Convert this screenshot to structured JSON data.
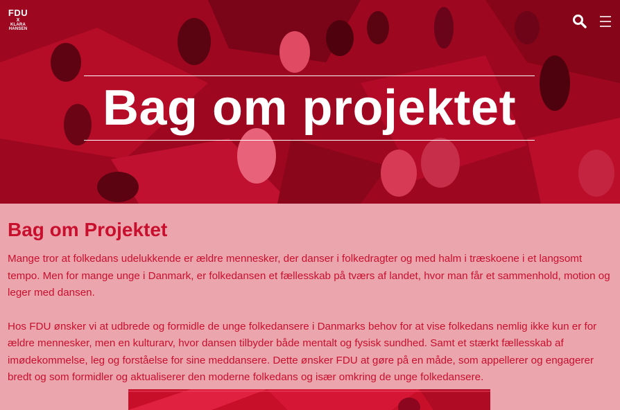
{
  "logo": {
    "line1": "FDU",
    "line2": "X",
    "line3": "KLARA",
    "line4": "HANSEN"
  },
  "header": {
    "search_icon": "search-icon",
    "menu_icon": "hamburger-menu-icon"
  },
  "hero": {
    "title": "Bag om projektet"
  },
  "main": {
    "heading": "Bag om Projektet",
    "paragraphs": [
      "Mange tror at folkedans udelukkende er ældre mennesker, der danser i folkedragter og med halm i træskoene i et langsomt tempo. Men for mange unge i Danmark, er folkedansen et fællesskab på tværs af landet, hvor man får et sammenhold, motion og leger med dansen.",
      "Hos FDU ønsker vi at udbrede og formidle de unge folkedansere i Danmarks behov for at vise folkedans nemlig ikke kun er for ældre mennesker, men en kulturarv, hvor dansen tilbyder både mentalt og fysisk sundhed. Samt et stærkt fællesskab af imødekommelse, leg og forståelse for sine meddansere. Dette ønsker FDU at gøre på en måde, som appellerer og engagerer bredt og som formidler og aktualiserer den moderne folkedans og især omkring de unge folkedansere."
    ]
  },
  "colors": {
    "accent": "#c8102e",
    "background": "#eba5ad",
    "hero_tint": "#a3071f"
  }
}
